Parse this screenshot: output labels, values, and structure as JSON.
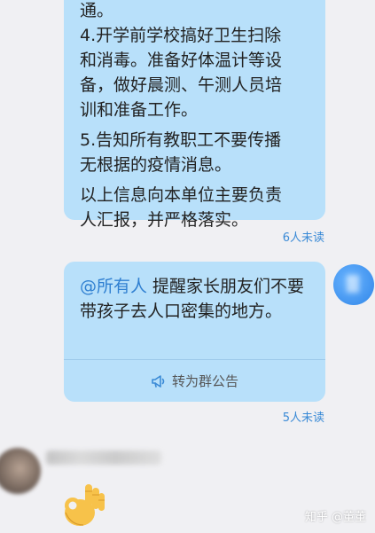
{
  "announcement_bubble": {
    "lines": [
      "通。",
      "4.开学前学校搞好卫生扫除",
      "和消毒。准备好体温计等设",
      "备，做好晨测、午测人员培",
      "训和准备工作。",
      "5.告知所有教职工不要传播",
      "无根据的疫情消息。",
      "以上信息向本单位主要负责",
      "人汇报，并严格落实。"
    ],
    "read_status": "6人未读"
  },
  "mention_bubble": {
    "mention": "@所有人",
    "message": "提醒家长朋友们不要带孩子去人口密集的地方。",
    "action_label": "转为群公告",
    "action_icon": "megaphone-icon",
    "read_status": "5人未读"
  },
  "incoming_message": {
    "emoji": "ok-hand"
  },
  "watermark": "知乎 @董董",
  "colors": {
    "bubble": "#b8e0fa",
    "mention": "#2f7fd1",
    "read_status": "#3a8ad6",
    "background": "#f0f0f3"
  }
}
